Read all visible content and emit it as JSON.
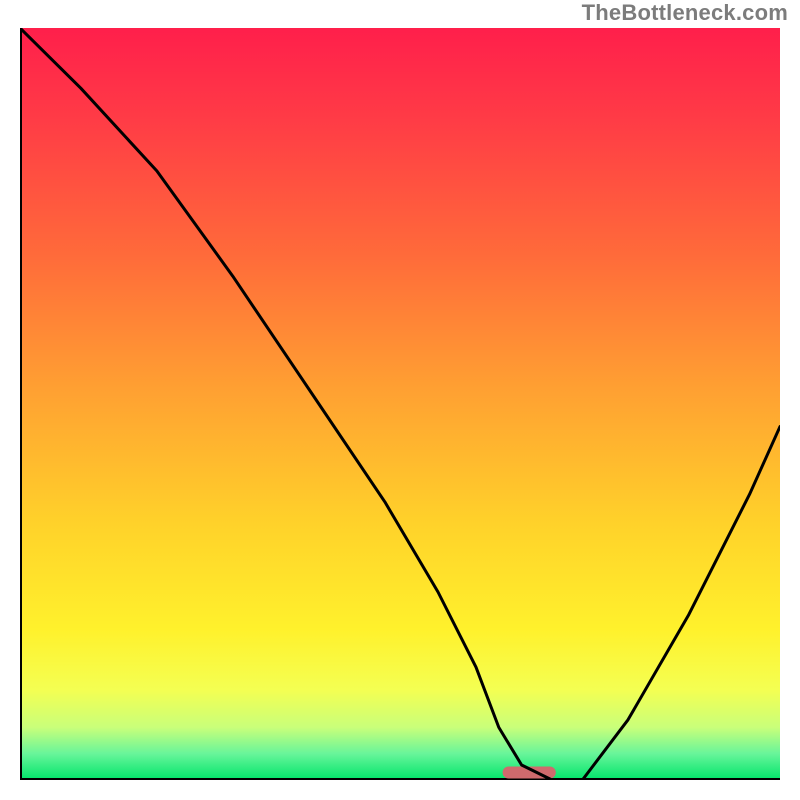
{
  "watermark": "TheBottleneck.com",
  "chart_data": {
    "type": "line",
    "title": "",
    "xlabel": "",
    "ylabel": "",
    "xlim": [
      0,
      100
    ],
    "ylim": [
      0,
      100
    ],
    "grid": false,
    "legend": false,
    "series": [
      {
        "name": "bottleneck-curve",
        "x": [
          0,
          8,
          18,
          28,
          38,
          48,
          55,
          60,
          63,
          66,
          70,
          74,
          80,
          88,
          96,
          100
        ],
        "y": [
          100,
          92,
          81,
          67,
          52,
          37,
          25,
          15,
          7,
          2,
          0,
          0,
          8,
          22,
          38,
          47
        ]
      }
    ],
    "marker": {
      "name": "bottleneck-marker",
      "x_center": 67,
      "y": 1,
      "width_x": 7,
      "color": "#cf6a6d"
    },
    "gradient_stops": [
      {
        "offset": 0.0,
        "color": "#ff1f4b"
      },
      {
        "offset": 0.12,
        "color": "#ff3b46"
      },
      {
        "offset": 0.3,
        "color": "#ff6a3a"
      },
      {
        "offset": 0.48,
        "color": "#ffa032"
      },
      {
        "offset": 0.66,
        "color": "#ffd22a"
      },
      {
        "offset": 0.8,
        "color": "#fff12c"
      },
      {
        "offset": 0.88,
        "color": "#f4ff52"
      },
      {
        "offset": 0.93,
        "color": "#c9ff7a"
      },
      {
        "offset": 0.965,
        "color": "#68f59a"
      },
      {
        "offset": 1.0,
        "color": "#00e56a"
      }
    ]
  }
}
